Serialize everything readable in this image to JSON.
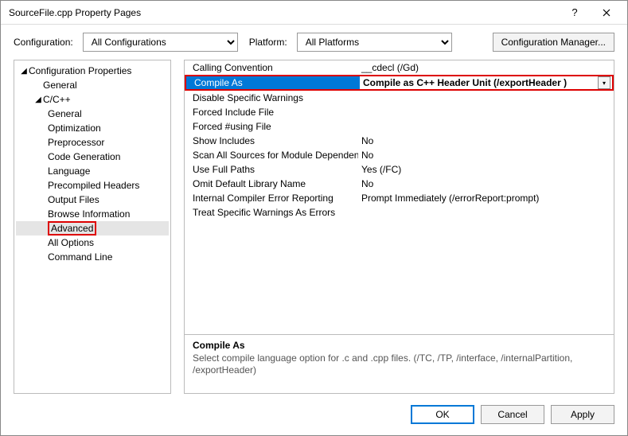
{
  "window": {
    "title": "SourceFile.cpp Property Pages"
  },
  "toolbar": {
    "config_label": "Configuration:",
    "config_value": "All Configurations",
    "platform_label": "Platform:",
    "platform_value": "All Platforms",
    "config_manager": "Configuration Manager..."
  },
  "tree": {
    "root": "Configuration Properties",
    "general": "General",
    "cpp": "C/C++",
    "items": [
      "General",
      "Optimization",
      "Preprocessor",
      "Code Generation",
      "Language",
      "Precompiled Headers",
      "Output Files",
      "Browse Information",
      "Advanced",
      "All Options",
      "Command Line"
    ],
    "selected_index": 8
  },
  "grid": [
    {
      "name": "Calling Convention",
      "value": "__cdecl (/Gd)"
    },
    {
      "name": "Compile As",
      "value": "Compile as C++ Header Unit (/exportHeader )",
      "selected": true
    },
    {
      "name": "Disable Specific Warnings",
      "value": ""
    },
    {
      "name": "Forced Include File",
      "value": ""
    },
    {
      "name": "Forced #using File",
      "value": ""
    },
    {
      "name": "Show Includes",
      "value": "No"
    },
    {
      "name": "Scan All Sources for Module Dependen",
      "value": "No"
    },
    {
      "name": "Use Full Paths",
      "value": "Yes (/FC)"
    },
    {
      "name": "Omit Default Library Name",
      "value": "No"
    },
    {
      "name": "Internal Compiler Error Reporting",
      "value": "Prompt Immediately (/errorReport:prompt)"
    },
    {
      "name": "Treat Specific Warnings As Errors",
      "value": ""
    }
  ],
  "description": {
    "title": "Compile As",
    "body": "Select compile language option for .c and .cpp files.   (/TC, /TP, /interface, /internalPartition, /exportHeader)"
  },
  "buttons": {
    "ok": "OK",
    "cancel": "Cancel",
    "apply": "Apply"
  }
}
